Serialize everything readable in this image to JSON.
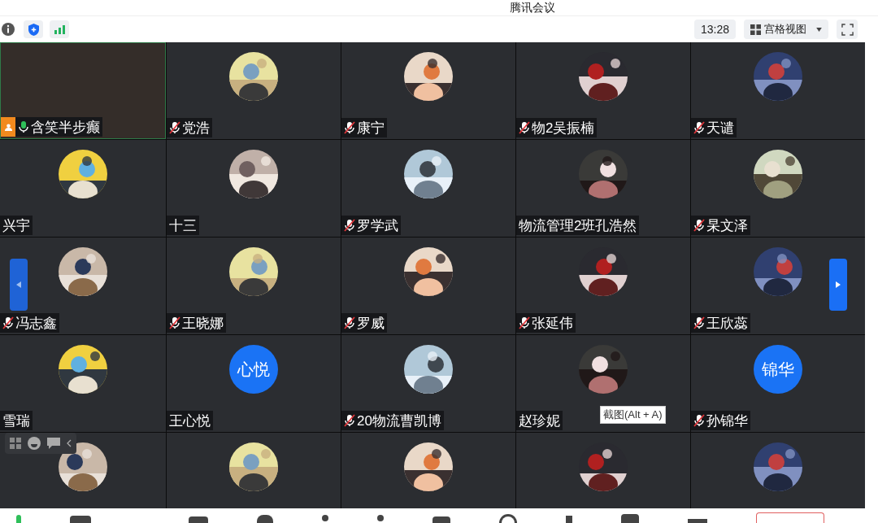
{
  "window": {
    "title": "腾讯会议"
  },
  "toolbar": {
    "time": "13:28",
    "view": {
      "label": "宫格视图"
    }
  },
  "tiles": [
    {
      "name": "含笑半步癫",
      "muted": false,
      "host": true,
      "avatar": {
        "kind": "video"
      }
    },
    {
      "name": "党浩",
      "muted": true,
      "avatar": {
        "kind": "picture"
      }
    },
    {
      "name": "康宁",
      "muted": true,
      "avatar": {
        "kind": "picture"
      }
    },
    {
      "name": "物2吴振楠",
      "muted": true,
      "avatar": {
        "kind": "picture"
      }
    },
    {
      "name": "天谴",
      "muted": true,
      "avatar": {
        "kind": "picture"
      }
    },
    {
      "name": "兴宇",
      "avatar": {
        "kind": "picture"
      }
    },
    {
      "name": "十三",
      "avatar": {
        "kind": "picture"
      }
    },
    {
      "name": "罗学武",
      "muted": true,
      "avatar": {
        "kind": "picture"
      }
    },
    {
      "name": "物流管理2班孔浩然",
      "avatar": {
        "kind": "picture"
      }
    },
    {
      "name": "杲文泽",
      "muted": true,
      "avatar": {
        "kind": "picture"
      }
    },
    {
      "name": "冯志鑫",
      "muted": true,
      "avatar": {
        "kind": "picture"
      }
    },
    {
      "name": "王晓娜",
      "muted": true,
      "avatar": {
        "kind": "picture"
      }
    },
    {
      "name": "罗威",
      "muted": true,
      "avatar": {
        "kind": "picture"
      }
    },
    {
      "name": "张延伟",
      "muted": true,
      "avatar": {
        "kind": "picture"
      }
    },
    {
      "name": "王欣蕊",
      "muted": true,
      "avatar": {
        "kind": "picture"
      }
    },
    {
      "name": "雪瑞",
      "avatar": {
        "kind": "picture"
      }
    },
    {
      "name": "王心悦",
      "avatar": {
        "kind": "initials",
        "text": "心悦"
      }
    },
    {
      "name": "20物流曹凯博",
      "muted": true,
      "avatar": {
        "kind": "picture"
      }
    },
    {
      "name": "赵珍妮",
      "avatar": {
        "kind": "picture"
      }
    },
    {
      "name": "孙锦华",
      "muted": true,
      "avatar": {
        "kind": "initials",
        "text": "锦华"
      }
    },
    {
      "avatar": {
        "kind": "picture"
      }
    },
    {
      "avatar": {
        "kind": "picture"
      }
    },
    {
      "avatar": {
        "kind": "picture"
      }
    },
    {
      "avatar": {
        "kind": "picture"
      }
    },
    {
      "avatar": {
        "kind": "picture"
      }
    }
  ],
  "tooltip": "截图(Alt + A)"
}
